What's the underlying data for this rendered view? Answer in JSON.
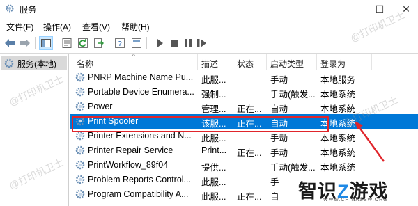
{
  "window": {
    "title": "服务",
    "minimize_glyph": "—",
    "maximize_glyph": "☐",
    "close_glyph": "✕"
  },
  "menu": [
    "文件(F)",
    "操作(A)",
    "查看(V)",
    "帮助(H)"
  ],
  "tree": {
    "root_label": "服务(本地)"
  },
  "table": {
    "columns": [
      "名称",
      "描述",
      "状态",
      "启动类型",
      "登录为"
    ],
    "rows": [
      {
        "name": "PNRP Machine Name Pu...",
        "desc": "此服...",
        "status": "",
        "startup": "手动",
        "logon": "本地服务"
      },
      {
        "name": "Portable Device Enumera...",
        "desc": "强制...",
        "status": "",
        "startup": "手动(触发...",
        "logon": "本地系统"
      },
      {
        "name": "Power",
        "desc": "管理...",
        "status": "正在...",
        "startup": "自动",
        "logon": "本地系统"
      },
      {
        "name": "Print Spooler",
        "desc": "该服...",
        "status": "正在...",
        "startup": "自动",
        "logon": "本地系统"
      },
      {
        "name": "Printer Extensions and N...",
        "desc": "此服...",
        "status": "",
        "startup": "手动",
        "logon": "本地系统"
      },
      {
        "name": "Printer Repair Service",
        "desc": "Print...",
        "status": "正在...",
        "startup": "手动",
        "logon": "本地系统"
      },
      {
        "name": "PrintWorkflow_89f04",
        "desc": "提供...",
        "status": "",
        "startup": "手动(触发...",
        "logon": "本地系统"
      },
      {
        "name": "Problem Reports Control...",
        "desc": "此服...",
        "status": "",
        "startup": "手",
        "logon": ""
      },
      {
        "name": "Program Compatibility A...",
        "desc": "此服...",
        "status": "正在...",
        "startup": "自",
        "logon": ""
      }
    ],
    "selected_index": 3
  },
  "watermark": "@打印机卫士",
  "brand": {
    "text_a": "智识",
    "text_z": "Z",
    "text_b": "游戏",
    "url": "WWW.CHINASSW.ORG"
  },
  "colors": {
    "selection": "#0078d7",
    "highlight_box": "#e0252b",
    "brand_accent": "#1e88e5"
  }
}
